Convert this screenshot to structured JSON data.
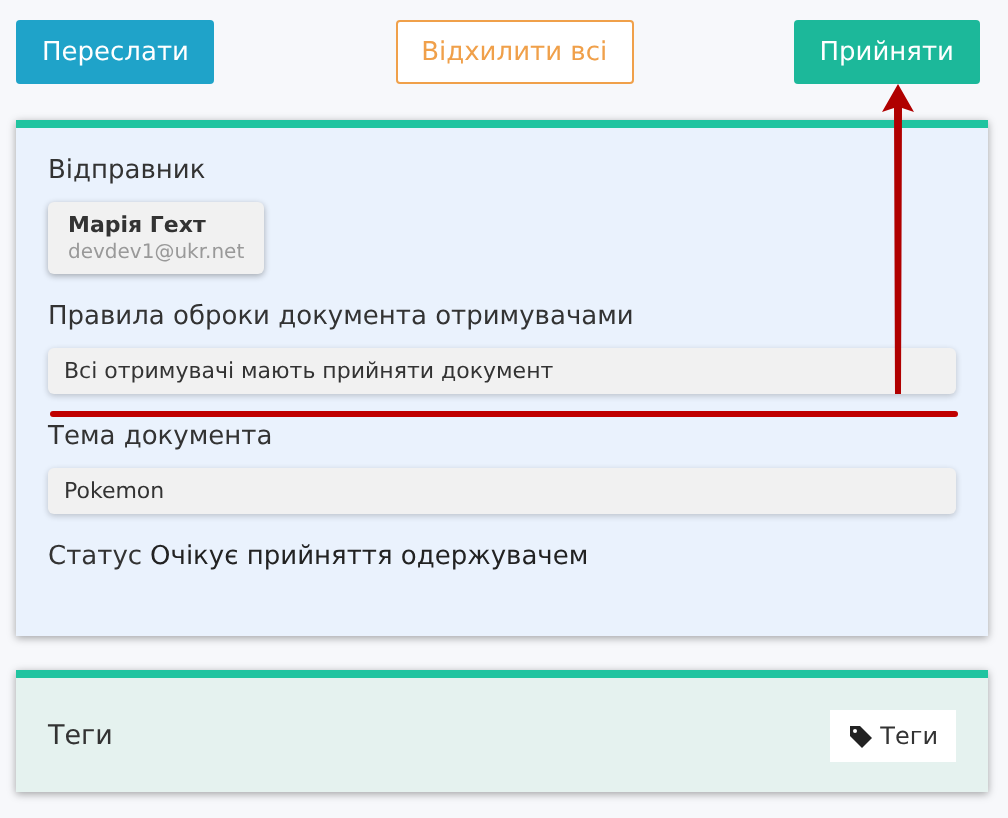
{
  "actions": [
    {
      "label": "Переслати",
      "kind": "info"
    },
    {
      "label": "Відхилити всі",
      "kind": "outline"
    },
    {
      "label": "Прийняти",
      "kind": "success"
    }
  ],
  "sender": {
    "label": "Відправник",
    "name": "Марія Гехт",
    "email": "devdev1@ukr.net"
  },
  "rules": {
    "label": "Правила оброки документа отримувачами",
    "value": "Всі отримувачі мають прийняти документ"
  },
  "subject": {
    "label": "Тема документа",
    "value": "Pokemon"
  },
  "status": {
    "label": "Статус",
    "value": "Очікує прийняття одержувачем"
  },
  "tags": {
    "label": "Теги",
    "button": "Теги"
  }
}
